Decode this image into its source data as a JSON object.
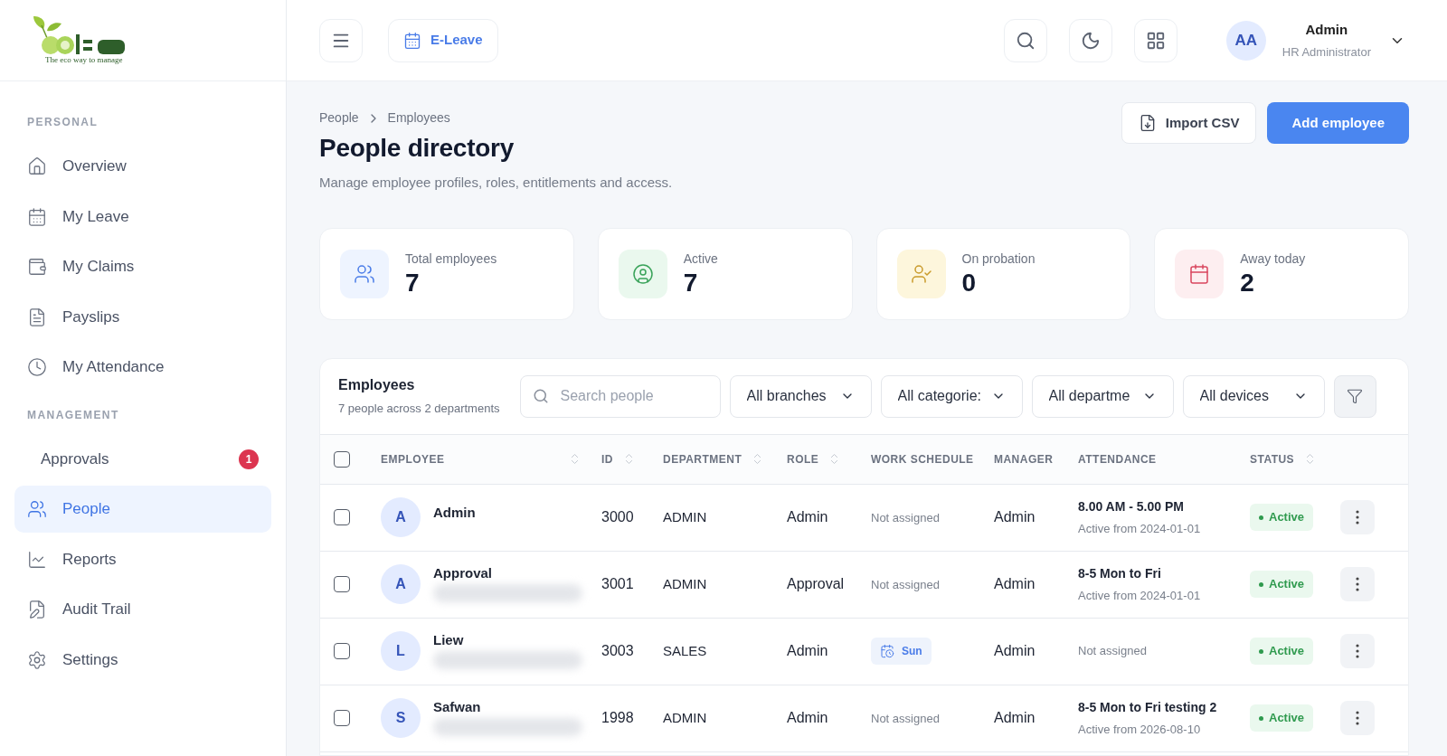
{
  "logo": {
    "tagline": "The eco way to manage"
  },
  "header": {
    "app_button": "E-Leave",
    "user": {
      "initials": "AA",
      "name": "Admin",
      "role": "HR Administrator"
    }
  },
  "sidebar": {
    "sections": [
      {
        "title": "PERSONAL",
        "items": [
          {
            "label": "Overview",
            "selected": false
          },
          {
            "label": "My Leave",
            "selected": false
          },
          {
            "label": "My Claims",
            "selected": false
          },
          {
            "label": "Payslips",
            "selected": false
          },
          {
            "label": "My Attendance",
            "selected": false
          }
        ]
      },
      {
        "title": "MANAGEMENT",
        "items": [
          {
            "label": "Approvals",
            "selected": false,
            "badge": "1"
          },
          {
            "label": "People",
            "selected": true
          },
          {
            "label": "Reports",
            "selected": false
          },
          {
            "label": "Audit Trail",
            "selected": false
          },
          {
            "label": "Settings",
            "selected": false
          }
        ]
      }
    ]
  },
  "breadcrumb": [
    "People",
    "Employees"
  ],
  "title": "People directory",
  "subtitle": "Manage employee profiles, roles, entitlements and access.",
  "actions": {
    "import": "Import CSV",
    "add": "Add employee"
  },
  "stats": [
    {
      "label": "Total employees",
      "value": "7"
    },
    {
      "label": "Active",
      "value": "7"
    },
    {
      "label": "On probation",
      "value": "0"
    },
    {
      "label": "Away today",
      "value": "2"
    }
  ],
  "table": {
    "title": "Employees",
    "summary": "7 people across 2 departments",
    "search_placeholder": "Search people",
    "filters": [
      "All branches",
      "All categorie:",
      "All departme",
      "All devices"
    ],
    "select_all": {
      "checked": false
    },
    "columns": [
      {
        "label": "EMPLOYEE",
        "sortable": true
      },
      {
        "label": "ID",
        "sortable": true
      },
      {
        "label": "DEPARTMENT",
        "sortable": true
      },
      {
        "label": "ROLE",
        "sortable": true
      },
      {
        "label": "WORK SCHEDULE",
        "sortable": false
      },
      {
        "label": "MANAGER",
        "sortable": false
      },
      {
        "label": "ATTENDANCE",
        "sortable": false
      },
      {
        "label": "STATUS",
        "sortable": true
      }
    ],
    "rows": [
      {
        "checked": false,
        "initial": "A",
        "name": "Admin",
        "redacted": false,
        "id": "3000",
        "department": "ADMIN",
        "role": "Admin",
        "schedule": {
          "kind": "text",
          "text": "Not assigned"
        },
        "manager": "Admin",
        "attendance": {
          "kind": "schedule",
          "title": "8.00 AM - 5.00 PM",
          "subtitle": "Active from 2024-01-01"
        },
        "status": "Active"
      },
      {
        "checked": false,
        "initial": "A",
        "name": "Approval",
        "redacted": true,
        "id": "3001",
        "department": "ADMIN",
        "role": "Approval",
        "schedule": {
          "kind": "text",
          "text": "Not assigned"
        },
        "manager": "Admin",
        "attendance": {
          "kind": "schedule",
          "title": "8-5 Mon to Fri",
          "subtitle": "Active from 2024-01-01"
        },
        "status": "Active"
      },
      {
        "checked": false,
        "initial": "L",
        "name": "Liew",
        "redacted": true,
        "id": "3003",
        "department": "SALES",
        "role": "Admin",
        "schedule": {
          "kind": "badge",
          "text": "Sun"
        },
        "manager": "Admin",
        "attendance": {
          "kind": "text",
          "title": "Not assigned"
        },
        "status": "Active"
      },
      {
        "checked": false,
        "initial": "S",
        "name": "Safwan",
        "redacted": true,
        "id": "1998",
        "department": "ADMIN",
        "role": "Admin",
        "schedule": {
          "kind": "text",
          "text": "Not assigned"
        },
        "manager": "Admin",
        "attendance": {
          "kind": "schedule",
          "title": "8-5 Mon to Fri testing 2",
          "subtitle": "Active from 2026-08-10"
        },
        "status": "Active"
      }
    ]
  }
}
